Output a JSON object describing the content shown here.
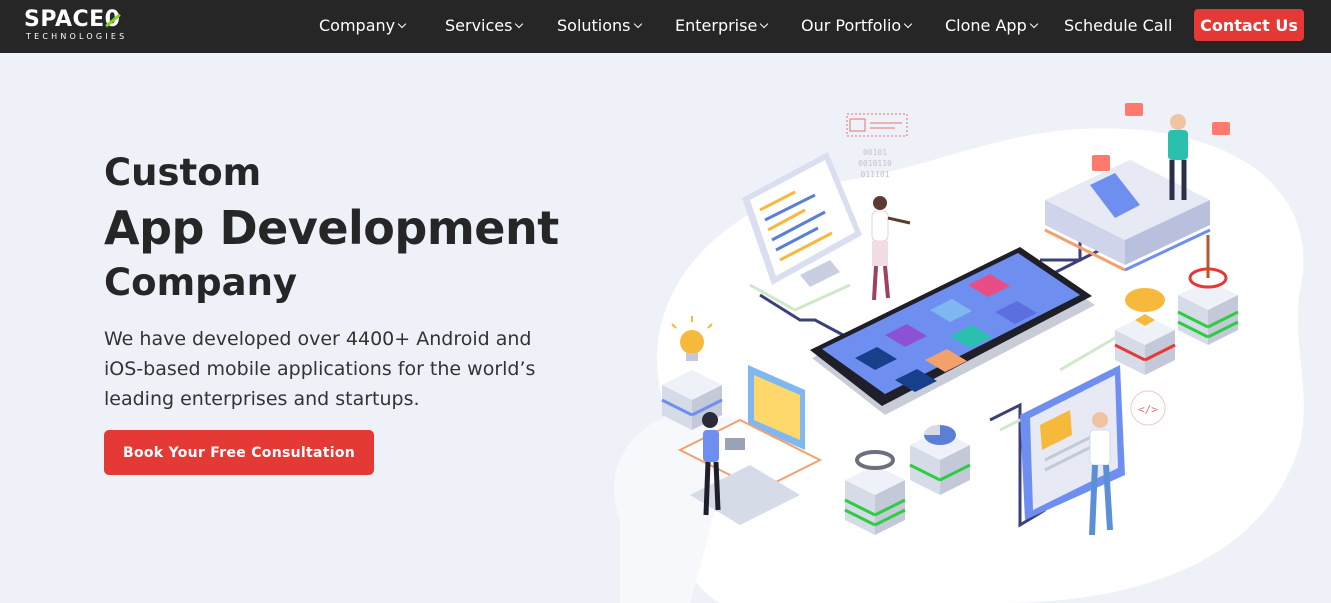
{
  "brand": {
    "name_prefix": "SPACE",
    "name_suffix": "0",
    "tagline": "TECHNOLOGIES"
  },
  "nav": {
    "items": [
      {
        "label": "Company",
        "has_dropdown": true
      },
      {
        "label": "Services",
        "has_dropdown": true
      },
      {
        "label": "Solutions",
        "has_dropdown": true
      },
      {
        "label": "Enterprise",
        "has_dropdown": true
      },
      {
        "label": "Our Portfolio",
        "has_dropdown": true
      },
      {
        "label": "Clone App",
        "has_dropdown": true
      },
      {
        "label": "Schedule Call",
        "has_dropdown": false
      }
    ],
    "contact_label": "Contact Us"
  },
  "hero": {
    "title_line1": "Custom",
    "title_line2": "App Development",
    "title_line3": "Company",
    "description": "We have developed over 4400+ Android and iOS-based mobile applications for the world’s leading enterprises and startups.",
    "cta_label": "Book Your Free Consultation",
    "illustration": {
      "binary_text": [
        "00101",
        "0010110",
        "011101"
      ],
      "code_tag": "</>"
    }
  },
  "colors": {
    "nav_bg": "#262626",
    "accent_red": "#e53935",
    "logo_green": "#7ed321",
    "hero_bg": "#eef1f8"
  }
}
